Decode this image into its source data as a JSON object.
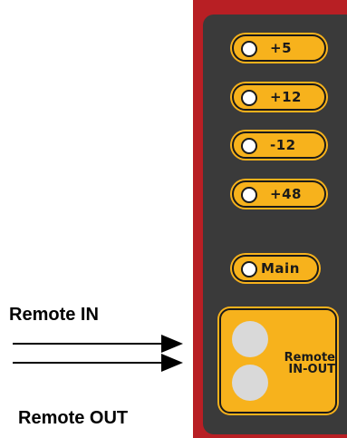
{
  "indicators": [
    {
      "label": "+5"
    },
    {
      "label": "+12"
    },
    {
      "label": "-12"
    },
    {
      "label": "+48"
    },
    {
      "label": "Main"
    }
  ],
  "remote": {
    "label_line1": "Remote",
    "label_line2": "IN-OUT"
  },
  "annotations": {
    "remote_in": "Remote IN",
    "remote_out": "Remote OUT"
  },
  "colors": {
    "frame": "#b81f24",
    "panel": "#3a3a3a",
    "accent": "#f7b21c",
    "led": "#ffffff",
    "port": "#d9d9d9"
  }
}
